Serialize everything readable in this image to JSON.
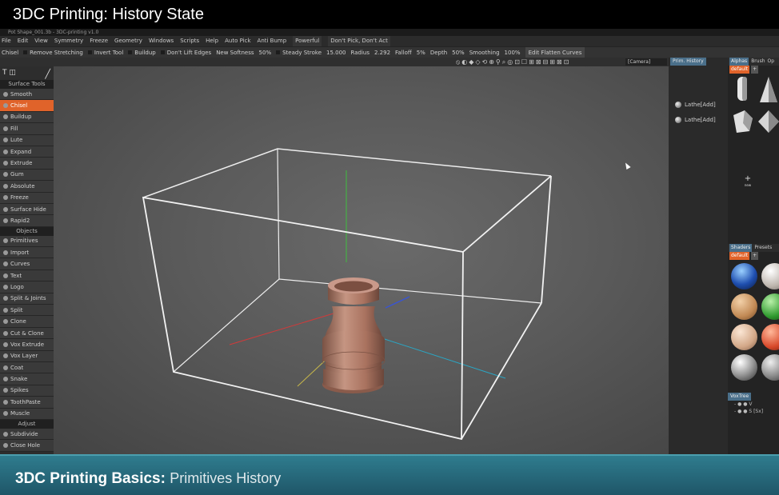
{
  "video": {
    "title": "3DC Printing: History State",
    "caption_bold": "3DC Printing Basics:",
    "caption_rest": "Primitives History"
  },
  "app": {
    "window_title": "Pot Shape_001.3b - 3DC-printing v1.0",
    "menu": [
      "File",
      "Edit",
      "View",
      "Symmetry",
      "Freeze",
      "Geometry",
      "Windows",
      "Scripts",
      "Help",
      "Auto Pick",
      "Anti Bump",
      "Powerful",
      "Don't Pick, Don't Act"
    ],
    "toolopts": {
      "tool": "Chisel",
      "remove_stretching": "Remove Stretching",
      "invert_tool": "Invert Tool",
      "buildup": "Buildup",
      "dont_lift_edges": "Don't Lift Edges",
      "new_softness": "New Softness",
      "softness_value": "50%",
      "steady_stroke": "Steady Stroke",
      "steady_value": "15.000",
      "radius": "Radius",
      "radius_value": "2.292",
      "falloff": "Falloff",
      "falloff_value": "5%",
      "depth": "Depth",
      "depth_value": "50%",
      "smoothing": "Smoothing",
      "smoothing_value": "100%",
      "edit_curves": "Edit Flatten Curves"
    },
    "icon_strip": "⦸◐◆◇⟲⊕⚲⌕◎⊡☐⊞⊠⊟⊞⊠⊡",
    "camera": "[Camera]"
  },
  "left_panel": {
    "top_icons": "T ◫",
    "surface_tools_header": "Surface Tools",
    "surface_tools": [
      "Smooth",
      "Chisel",
      "Buildup",
      "Fill",
      "Lute",
      "Expand",
      "Extrude",
      "Gum",
      "Absolute",
      "Freeze",
      "Surface Hide",
      "Rapid2"
    ],
    "active_tool": "Chisel",
    "objects_header": "Objects",
    "objects": [
      "Primitives",
      "Import",
      "Curves",
      "Text",
      "Logo",
      "Split & Joints",
      "Split",
      "Clone",
      "Cut & Clone",
      "Vox Extrude",
      "Vox Layer",
      "Coat",
      "Snake",
      "Spikes",
      "ToothPaste",
      "Muscle"
    ],
    "adjust_header": "Adjust",
    "adjust": [
      "Subdivide",
      "Close Hole"
    ]
  },
  "history_panel": {
    "tabs": [
      "Prim. History"
    ],
    "items": [
      "Lathe[Add]",
      "Lathe[Add]"
    ]
  },
  "right_panel": {
    "tabs": [
      "Alphas",
      "Brush",
      "Op"
    ],
    "default_tag": "default",
    "new_label": "new",
    "shader_tabs": [
      "Shaders",
      "Presets"
    ],
    "vox_tag": "VoxTree",
    "vox_lines": [
      "- ● ● V",
      "- ● ● S [Sx]"
    ]
  },
  "colors": {
    "accent_orange": "#e0632a",
    "tab_blue": "#4a6f8a",
    "caption_bar": "#2f7c8e",
    "pot_color": "#b88572"
  }
}
